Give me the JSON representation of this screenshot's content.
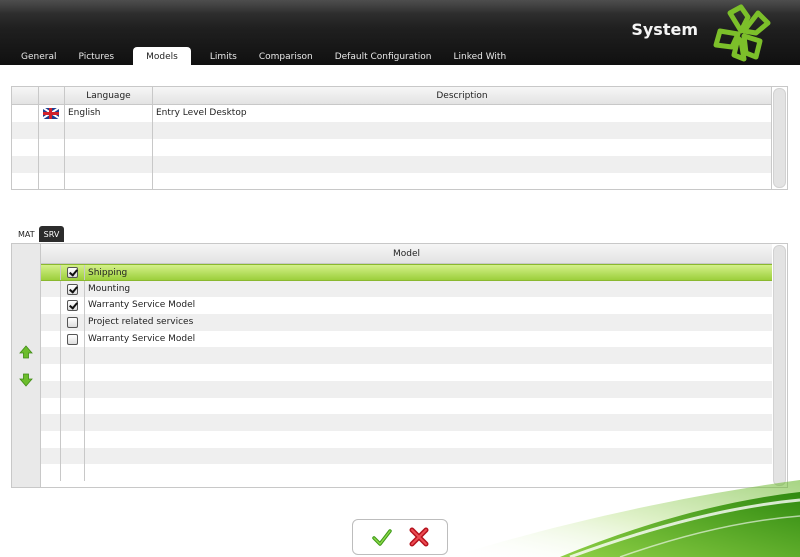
{
  "app": {
    "title": "System"
  },
  "tabs": [
    {
      "label": "General",
      "active": false
    },
    {
      "label": "Pictures",
      "active": false
    },
    {
      "label": "Models",
      "active": true
    },
    {
      "label": "Limits",
      "active": false
    },
    {
      "label": "Comparison",
      "active": false
    },
    {
      "label": "Default Configuration",
      "active": false
    },
    {
      "label": "Linked With",
      "active": false
    }
  ],
  "language_grid": {
    "headers": {
      "language": "Language",
      "description": "Description"
    },
    "rows": [
      {
        "flag": "uk-flag-icon",
        "language": "English",
        "description": "Entry Level Desktop"
      }
    ],
    "empty_rows": 4
  },
  "subtabs": [
    {
      "label": "MAT",
      "active": false
    },
    {
      "label": "SRV",
      "active": true
    }
  ],
  "model_grid": {
    "header": "Model",
    "rows": [
      {
        "label": "Shipping",
        "checked": true,
        "selected": true
      },
      {
        "label": "Mounting",
        "checked": true,
        "selected": false
      },
      {
        "label": "Warranty Service Model",
        "checked": true,
        "selected": false
      },
      {
        "label": "Project related services",
        "checked": false,
        "selected": false
      },
      {
        "label": "Warranty Service Model",
        "checked": false,
        "selected": false
      }
    ],
    "empty_rows": 8
  },
  "icons": {
    "move_up": "arrow-up-icon",
    "move_down": "arrow-down-icon",
    "confirm": "check-icon",
    "cancel": "close-icon",
    "logo": "clover-logo-icon"
  },
  "colors": {
    "accent_green": "#7cbf2a",
    "header_dark": "#1f1f1f",
    "selected_row": "#b6e05a",
    "cancel_red": "#d81e2a"
  }
}
